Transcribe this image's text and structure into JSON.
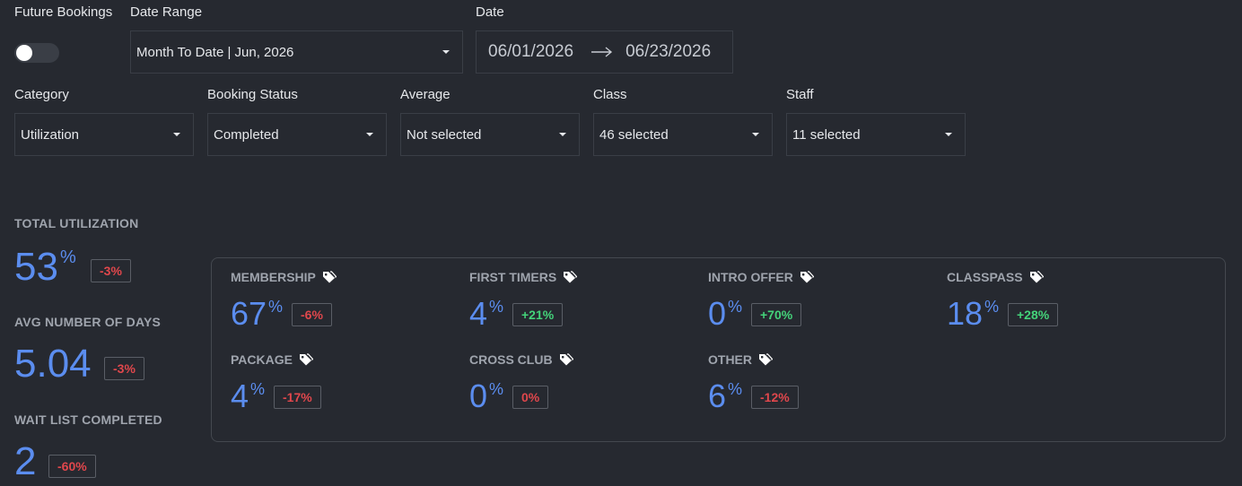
{
  "filters": {
    "future_bookings": {
      "label": "Future Bookings",
      "enabled": false
    },
    "date_range": {
      "label": "Date Range",
      "value": "Month To Date | Jun, 2026"
    },
    "date": {
      "label": "Date",
      "start": "06/01/2026",
      "end": "06/23/2026"
    },
    "category": {
      "label": "Category",
      "value": "Utilization"
    },
    "booking_status": {
      "label": "Booking Status",
      "value": "Completed"
    },
    "average": {
      "label": "Average",
      "value": "Not selected"
    },
    "class": {
      "label": "Class",
      "value": "46 selected"
    },
    "staff": {
      "label": "Staff",
      "value": "11 selected"
    }
  },
  "summary": {
    "total_utilization": {
      "title": "TOTAL UTILIZATION",
      "value": "53",
      "unit": "%",
      "change": "-3%"
    },
    "avg_days": {
      "title": "AVG NUMBER OF DAYS",
      "value": "5.04",
      "change": "-3%"
    },
    "wait_list": {
      "title": "WAIT LIST COMPLETED",
      "value": "2",
      "change": "-60%"
    }
  },
  "breakdown": [
    {
      "title": "MEMBERSHIP",
      "value": "67",
      "unit": "%",
      "change": "-6%",
      "trend": "negative"
    },
    {
      "title": "FIRST TIMERS",
      "value": "4",
      "unit": "%",
      "change": "+21%",
      "trend": "positive"
    },
    {
      "title": "INTRO OFFER",
      "value": "0",
      "unit": "%",
      "change": "+70%",
      "trend": "positive"
    },
    {
      "title": "CLASSPASS",
      "value": "18",
      "unit": "%",
      "change": "+28%",
      "trend": "positive"
    },
    {
      "title": "PACKAGE",
      "value": "4",
      "unit": "%",
      "change": "-17%",
      "trend": "negative"
    },
    {
      "title": "CROSS CLUB",
      "value": "0",
      "unit": "%",
      "change": "0%",
      "trend": "negative"
    },
    {
      "title": "OTHER",
      "value": "6",
      "unit": "%",
      "change": "-12%",
      "trend": "negative"
    }
  ],
  "icons": {
    "dropdown": "caret-down-icon",
    "range_arrow": "arrow-right-icon",
    "card_tag": "tag-icon"
  },
  "colors": {
    "background": "#262930",
    "accent": "#5b8def",
    "negative": "#e0474c",
    "positive": "#44d37a"
  }
}
